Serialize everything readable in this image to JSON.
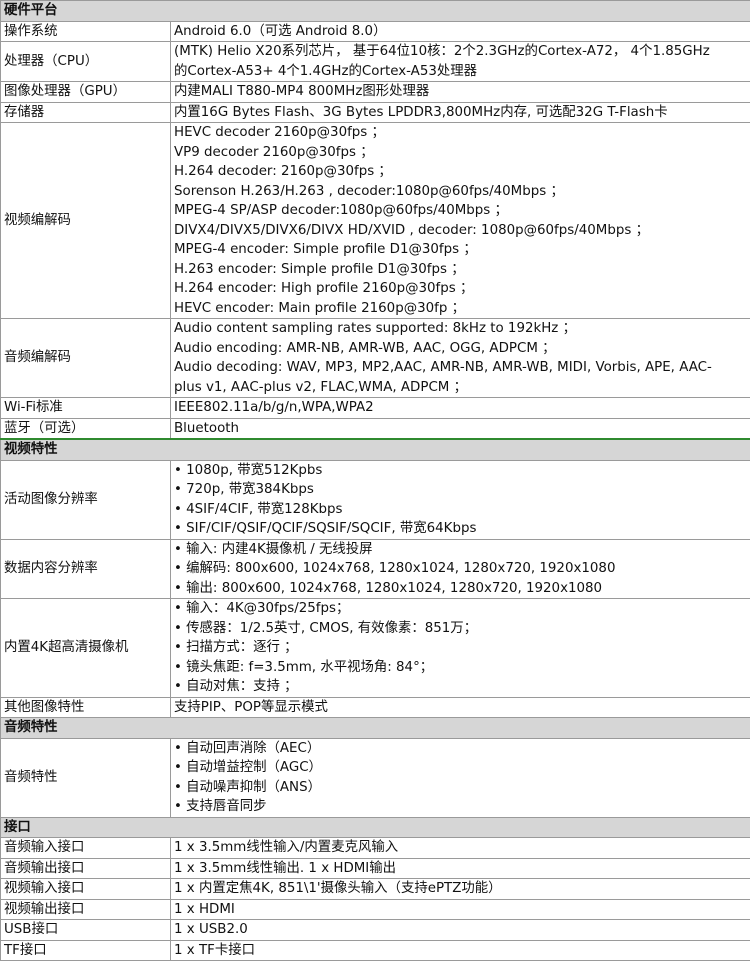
{
  "sections": [
    {
      "title": "硬件平台",
      "rows": [
        {
          "label": "操作系统",
          "lines": [
            "Android 6.0（可选 Android 8.0）"
          ]
        },
        {
          "label": "处理器（CPU）",
          "lines": [
            "(MTK) Helio X20系列芯片， 基于64位10核：2个2.3GHz的Cortex-A72， 4个1.85GHz",
            "的Cortex-A53+ 4个1.4GHz的Cortex-A53处理器"
          ]
        },
        {
          "label": "图像处理器（GPU）",
          "lines": [
            "内建MALI T880-MP4 800MHz图形处理器"
          ]
        },
        {
          "label": "存储器",
          "lines": [
            "内置16G Bytes Flash、3G Bytes LPDDR3,800MHz内存, 可选配32G T-Flash卡"
          ]
        },
        {
          "label": "视频编解码",
          "lines": [
            "HEVC decoder 2160p@30fps ；",
            "VP9 decoder 2160p@30fps ；",
            "H.264 decoder: 2160p@30fps ；",
            "Sorenson H.263/H.263 , decoder:1080p@60fps/40Mbps ；",
            "MPEG-4 SP/ASP decoder:1080p@60fps/40Mbps ；",
            "DIVX4/DIVX5/DIVX6/DIVX HD/XVID , decoder: 1080p@60fps/40Mbps ；",
            "MPEG-4 encoder: Simple profile D1@30fps ；",
            "H.263 encoder: Simple profile D1@30fps ；",
            "H.264 encoder: High profile 2160p@30fps ；",
            "HEVC encoder: Main profile 2160p@30fp ；"
          ]
        },
        {
          "label": "音频编解码",
          "lines": [
            "Audio content sampling rates supported: 8kHz to 192kHz ；",
            "Audio encoding: AMR-NB, AMR-WB, AAC, OGG, ADPCM ；",
            "Audio decoding: WAV, MP3, MP2,AAC, AMR-NB, AMR-WB, MIDI, Vorbis, APE, AAC-",
            "plus v1, AAC-plus v2, FLAC,WMA, ADPCM ；"
          ]
        },
        {
          "label": "Wi-Fi标准",
          "lines": [
            "IEEE802.11a/b/g/n,WPA,WPA2"
          ]
        },
        {
          "label": "蓝牙（可选）",
          "lines": [
            "Bluetooth"
          ]
        }
      ]
    },
    {
      "title": "视频特性",
      "rows": [
        {
          "label": "活动图像分辨率",
          "lines": [
            "• 1080p, 带宽512Kpbs",
            "• 720p, 带宽384Kbps",
            "• 4SIF/4CIF, 带宽128Kbps",
            "• SIF/CIF/QSIF/QCIF/SQSIF/SQCIF, 带宽64Kbps"
          ]
        },
        {
          "label": "数据内容分辨率",
          "lines": [
            "• 输入: 内建4K摄像机 / 无线投屏",
            "• 编解码: 800x600, 1024x768, 1280x1024, 1280x720, 1920x1080",
            "• 输出: 800x600, 1024x768, 1280x1024, 1280x720, 1920x1080"
          ]
        },
        {
          "label": "内置4K超高清摄像机",
          "lines": [
            "• 输入：4K@30fps/25fps；",
            "• 传感器：1/2.5英寸, CMOS, 有效像素：851万；",
            "• 扫描方式：逐行 ；",
            "• 镜头焦距: f=3.5mm, 水平视场角: 84°；",
            "• 自动对焦：支持 ；"
          ]
        },
        {
          "label": "其他图像特性",
          "lines": [
            "支持PIP、POP等显示模式"
          ]
        }
      ]
    },
    {
      "title": "音频特性",
      "rows": [
        {
          "label": "音频特性",
          "lines": [
            "• 自动回声消除（AEC）",
            "• 自动增益控制（AGC）",
            "• 自动噪声抑制（ANS）",
            "• 支持唇音同步"
          ]
        }
      ]
    },
    {
      "title": "接口",
      "rows": [
        {
          "label": "音频输入接口",
          "lines": [
            "1 x 3.5mm线性输入/内置麦克风输入"
          ]
        },
        {
          "label": "音频输出接口",
          "lines": [
            "1 x 3.5mm线性输出. 1 x HDMI输出"
          ]
        },
        {
          "label": "视频输入接口",
          "lines": [
            "1 x 内置定焦4K, 851\\1'摄像头输入（支持ePTZ功能）"
          ]
        },
        {
          "label": "视频输出接口",
          "lines": [
            "1 x HDMI"
          ]
        },
        {
          "label": "USB接口",
          "lines": [
            "1 x USB2.0"
          ]
        },
        {
          "label": "TF接口",
          "lines": [
            "1 x TF卡接口"
          ]
        }
      ]
    }
  ]
}
